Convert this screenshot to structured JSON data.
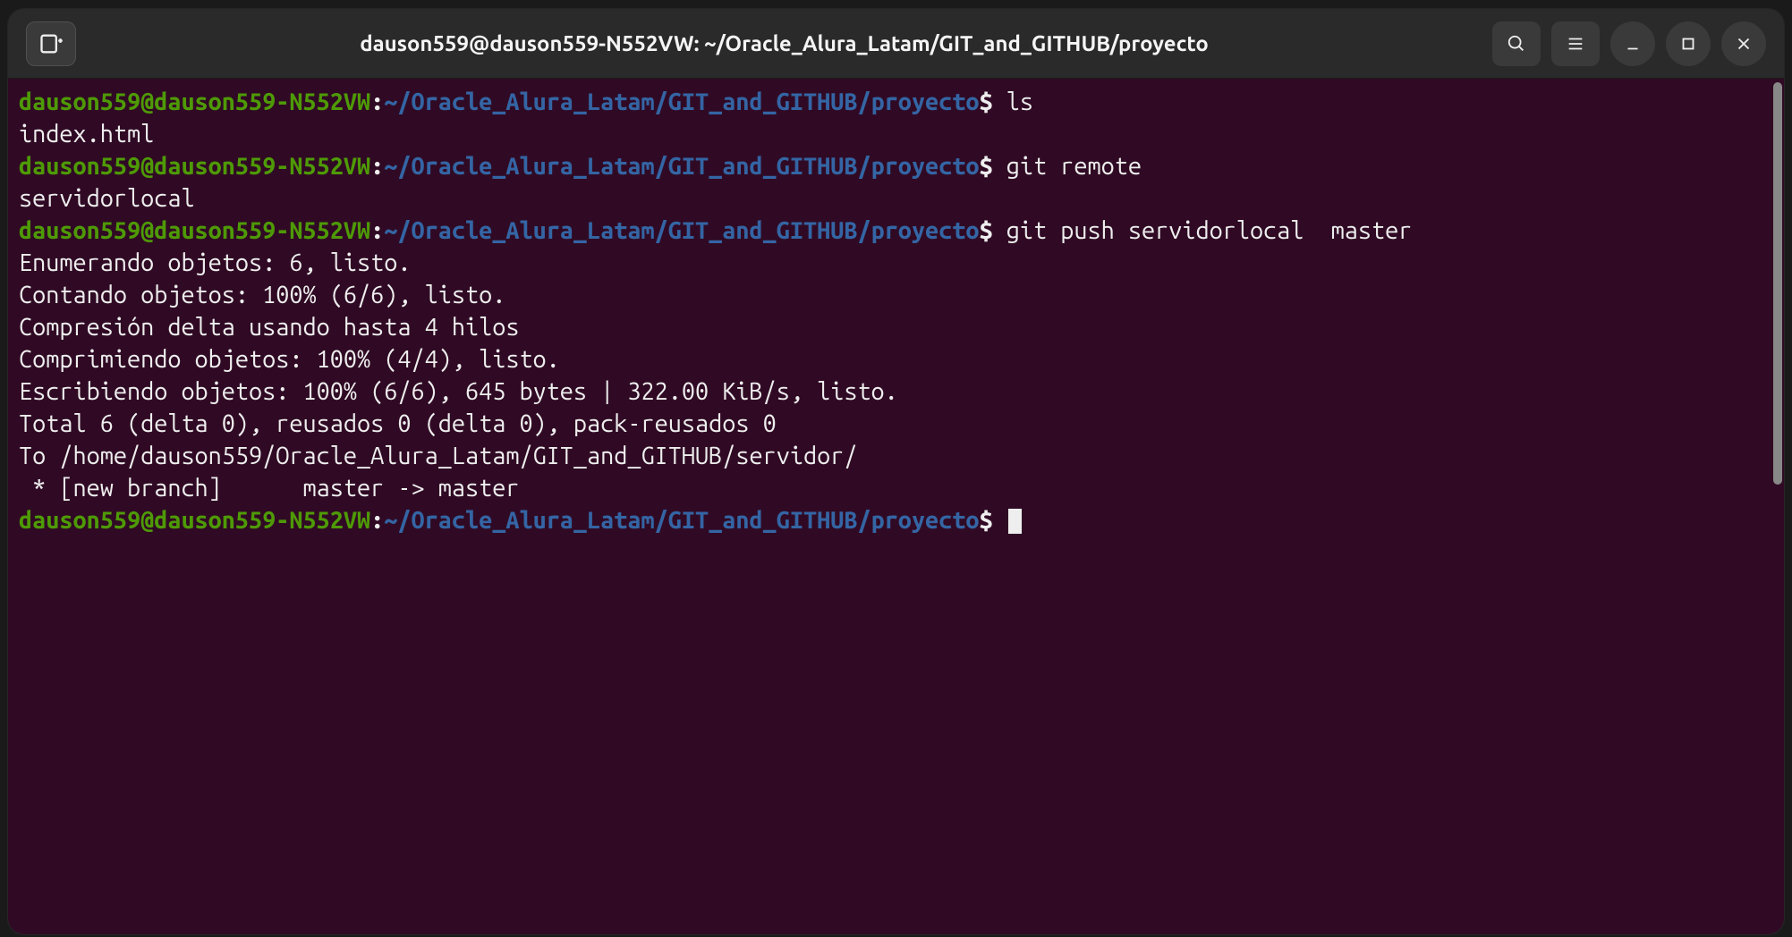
{
  "titlebar": {
    "title": "dauson559@dauson559-N552VW: ~/Oracle_Alura_Latam/GIT_and_GITHUB/proyecto"
  },
  "prompt": {
    "user_host": "dauson559@dauson559-N552VW",
    "colon": ":",
    "path": "~/Oracle_Alura_Latam/GIT_and_GITHUB/proyecto",
    "symbol": "$ "
  },
  "lines": {
    "cmd1": "ls",
    "out1": "index.html",
    "cmd2": "git remote",
    "out2": "servidorlocal",
    "cmd3": "git push servidorlocal  master",
    "out3": "Enumerando objetos: 6, listo.",
    "out4": "Contando objetos: 100% (6/6), listo.",
    "out5": "Compresión delta usando hasta 4 hilos",
    "out6": "Comprimiendo objetos: 100% (4/4), listo.",
    "out7": "Escribiendo objetos: 100% (6/6), 645 bytes | 322.00 KiB/s, listo.",
    "out8": "Total 6 (delta 0), reusados 0 (delta 0), pack-reusados 0",
    "out9": "To /home/dauson559/Oracle_Alura_Latam/GIT_and_GITHUB/servidor/",
    "out10": " * [new branch]      master -> master"
  }
}
